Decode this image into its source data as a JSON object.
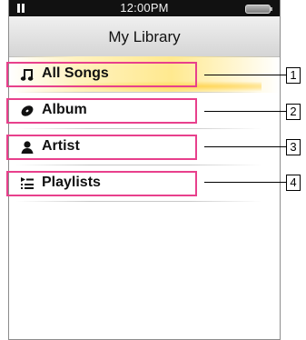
{
  "statusbar": {
    "time": "12:00PM",
    "playback_icon": "pause-icon",
    "battery_icon": "battery-icon"
  },
  "header": {
    "title": "My Library"
  },
  "menu": {
    "items": [
      {
        "label": "All Songs",
        "icon": "music-note-icon",
        "selected": true
      },
      {
        "label": "Album",
        "icon": "disc-icon",
        "selected": false
      },
      {
        "label": "Artist",
        "icon": "person-icon",
        "selected": false
      },
      {
        "label": "Playlists",
        "icon": "playlist-icon",
        "selected": false
      }
    ]
  },
  "callouts": {
    "numbers": [
      "1",
      "2",
      "3",
      "4"
    ]
  },
  "colors": {
    "highlight_box": "#e8408c",
    "selection": "#ffe98f"
  }
}
